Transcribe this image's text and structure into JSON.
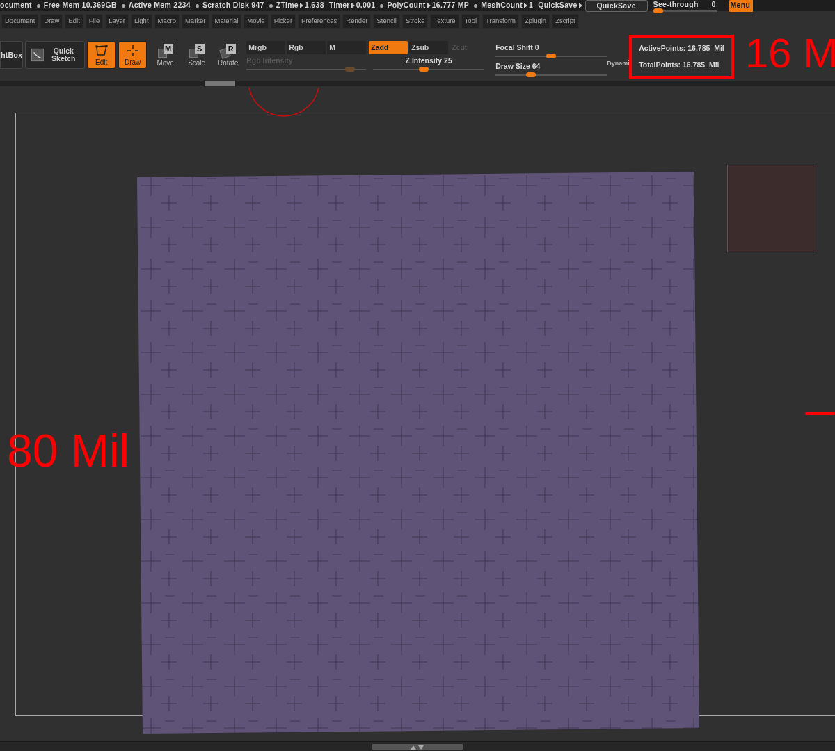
{
  "status_bar": [
    {
      "kind": "plain",
      "dot": false,
      "text": "ocument"
    },
    {
      "kind": "plain",
      "dot": true,
      "text": "Free Mem 10.369GB"
    },
    {
      "kind": "plain",
      "dot": true,
      "text": "Active Mem 2234"
    },
    {
      "kind": "plain",
      "dot": true,
      "text": "Scratch Disk 947"
    },
    {
      "kind": "arrow",
      "dot": true,
      "label": "ZTime",
      "value": "1.638"
    },
    {
      "kind": "arrow",
      "dot": false,
      "label": "Timer",
      "value": "0.001"
    },
    {
      "kind": "arrow",
      "dot": true,
      "label": "PolyCount",
      "value": "16.777 MP"
    },
    {
      "kind": "arrow",
      "dot": true,
      "label": "MeshCount",
      "value": "1"
    },
    {
      "kind": "arrow",
      "dot": false,
      "label": "QuickSave"
    }
  ],
  "quicksave_button": "QuickSave",
  "see_through": {
    "label": "See-through",
    "value": "0",
    "level": 0
  },
  "menu_button": "Menu",
  "menus": [
    "Document",
    "Draw",
    "Edit",
    "File",
    "Layer",
    "Light",
    "Macro",
    "Marker",
    "Material",
    "Movie",
    "Picker",
    "Preferences",
    "Render",
    "Stencil",
    "Stroke",
    "Texture",
    "Tool",
    "Transform",
    "Zplugin",
    "Zscript"
  ],
  "toolbar": {
    "large_buttons": [
      "htBox",
      "Quick Sketch"
    ],
    "modes": [
      {
        "kind": "edit",
        "label": "Edit",
        "selected": true
      },
      {
        "kind": "draw",
        "label": "Draw",
        "selected": true
      },
      {
        "kind": "move",
        "label": "Move",
        "letter": "M",
        "selected": false
      },
      {
        "kind": "scale",
        "label": "Scale",
        "letter": "S",
        "selected": false
      },
      {
        "kind": "rotate",
        "label": "Rotate",
        "letter": "R",
        "selected": false
      }
    ],
    "color_modes": [
      {
        "label": "Mrgb",
        "selected": false
      },
      {
        "label": "Rgb",
        "selected": false
      },
      {
        "label": "M",
        "selected": false
      }
    ],
    "z_modes": [
      {
        "label": "Zadd",
        "selected": true,
        "disabled": false
      },
      {
        "label": "Zsub",
        "selected": false,
        "disabled": false
      },
      {
        "label": "Zcut",
        "selected": false,
        "disabled": true
      }
    ],
    "rgb_intensity": {
      "label": "Rgb Intensity",
      "disabled": true,
      "level": 0.9
    },
    "z_intensity": {
      "label": "Z Intensity",
      "value": "25",
      "level": 0.45
    },
    "focal_shift": {
      "label": "Focal Shift",
      "value": "0",
      "level": 0.5
    },
    "draw_size": {
      "label": "Draw Size",
      "value": "64",
      "level": 0.3
    },
    "dynamic": "Dynami",
    "points": [
      {
        "label": "ActivePoints:",
        "value": "16.785  Mil"
      },
      {
        "label": "TotalPoints:",
        "value": "16.785  Mil"
      }
    ]
  },
  "annotations": [
    {
      "kind": "points",
      "text": "16 M"
    },
    {
      "kind": "canvas",
      "text": "80 Mil"
    }
  ]
}
